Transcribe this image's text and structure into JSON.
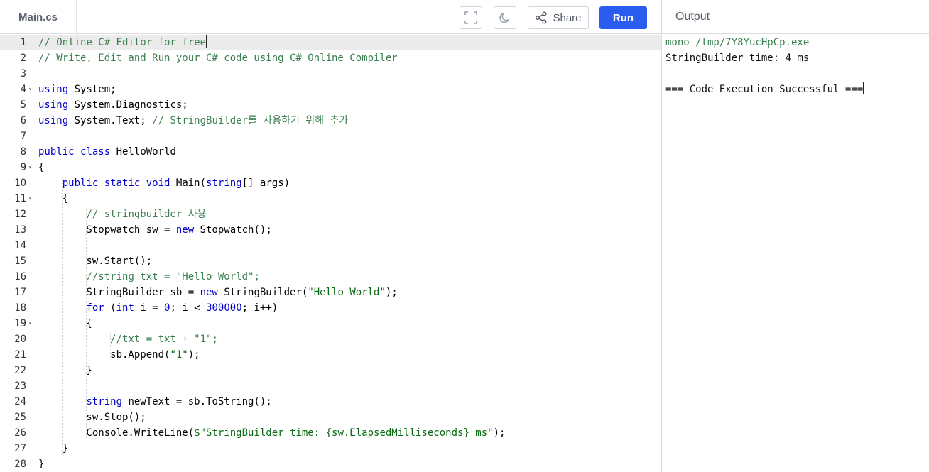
{
  "editor": {
    "file_tab": "Main.cs",
    "share_label": "Share",
    "run_label": "Run",
    "lines": [
      {
        "n": "1",
        "tokens": [
          [
            "comment",
            "// Online C# Editor for free"
          ]
        ],
        "cursor": true,
        "active": true
      },
      {
        "n": "2",
        "tokens": [
          [
            "comment",
            "// Write, Edit and Run your C# code using C# Online Compiler"
          ]
        ]
      },
      {
        "n": "3",
        "tokens": []
      },
      {
        "n": "4",
        "fold": true,
        "tokens": [
          [
            "kw",
            "using"
          ],
          [
            "plain",
            " System;"
          ]
        ]
      },
      {
        "n": "5",
        "tokens": [
          [
            "kw",
            "using"
          ],
          [
            "plain",
            " System.Diagnostics;"
          ]
        ]
      },
      {
        "n": "6",
        "tokens": [
          [
            "kw",
            "using"
          ],
          [
            "plain",
            " System.Text; "
          ],
          [
            "comment",
            "// StringBuilder를 사용하기 위해 추가"
          ]
        ]
      },
      {
        "n": "7",
        "tokens": []
      },
      {
        "n": "8",
        "tokens": [
          [
            "kw",
            "public"
          ],
          [
            "plain",
            " "
          ],
          [
            "kw",
            "class"
          ],
          [
            "plain",
            " HelloWorld"
          ]
        ]
      },
      {
        "n": "9",
        "fold": true,
        "tokens": [
          [
            "plain",
            "{"
          ]
        ]
      },
      {
        "n": "10",
        "tokens": [
          [
            "plain",
            "    "
          ],
          [
            "kw",
            "public"
          ],
          [
            "plain",
            " "
          ],
          [
            "kw",
            "static"
          ],
          [
            "plain",
            " "
          ],
          [
            "kw",
            "void"
          ],
          [
            "plain",
            " Main("
          ],
          [
            "kw",
            "string"
          ],
          [
            "plain",
            "[] args)"
          ]
        ]
      },
      {
        "n": "11",
        "fold": true,
        "tokens": [
          [
            "plain",
            "    {"
          ]
        ]
      },
      {
        "n": "12",
        "tokens": [
          [
            "plain",
            "        "
          ],
          [
            "comment",
            "// stringbuilder 사용"
          ]
        ]
      },
      {
        "n": "13",
        "tokens": [
          [
            "plain",
            "        Stopwatch sw = "
          ],
          [
            "kw",
            "new"
          ],
          [
            "plain",
            " Stopwatch();"
          ]
        ]
      },
      {
        "n": "14",
        "tokens": []
      },
      {
        "n": "15",
        "tokens": [
          [
            "plain",
            "        sw.Start();"
          ]
        ]
      },
      {
        "n": "16",
        "tokens": [
          [
            "plain",
            "        "
          ],
          [
            "comment",
            "//string txt = \"Hello World\";"
          ]
        ]
      },
      {
        "n": "17",
        "tokens": [
          [
            "plain",
            "        StringBuilder sb = "
          ],
          [
            "kw",
            "new"
          ],
          [
            "plain",
            " StringBuilder("
          ],
          [
            "str",
            "\"Hello World\""
          ],
          [
            "plain",
            ");"
          ]
        ]
      },
      {
        "n": "18",
        "tokens": [
          [
            "plain",
            "        "
          ],
          [
            "kw",
            "for"
          ],
          [
            "plain",
            " ("
          ],
          [
            "kw",
            "int"
          ],
          [
            "plain",
            " i = "
          ],
          [
            "num",
            "0"
          ],
          [
            "plain",
            "; i < "
          ],
          [
            "num",
            "300000"
          ],
          [
            "plain",
            "; i++)"
          ]
        ]
      },
      {
        "n": "19",
        "fold": true,
        "tokens": [
          [
            "plain",
            "        {"
          ]
        ]
      },
      {
        "n": "20",
        "tokens": [
          [
            "plain",
            "            "
          ],
          [
            "comment",
            "//txt = txt + \"1\";"
          ]
        ]
      },
      {
        "n": "21",
        "tokens": [
          [
            "plain",
            "            sb.Append("
          ],
          [
            "str",
            "\"1\""
          ],
          [
            "plain",
            ");"
          ]
        ]
      },
      {
        "n": "22",
        "tokens": [
          [
            "plain",
            "        }"
          ]
        ]
      },
      {
        "n": "23",
        "tokens": []
      },
      {
        "n": "24",
        "tokens": [
          [
            "plain",
            "        "
          ],
          [
            "kw",
            "string"
          ],
          [
            "plain",
            " newText = sb.ToString();"
          ]
        ]
      },
      {
        "n": "25",
        "tokens": [
          [
            "plain",
            "        sw.Stop();"
          ]
        ]
      },
      {
        "n": "26",
        "tokens": [
          [
            "plain",
            "        Console.WriteLine("
          ],
          [
            "str",
            "$\"StringBuilder time: {sw.ElapsedMilliseconds} ms\""
          ],
          [
            "plain",
            ");"
          ]
        ]
      },
      {
        "n": "27",
        "tokens": [
          [
            "plain",
            "    }"
          ]
        ]
      },
      {
        "n": "28",
        "tokens": [
          [
            "plain",
            "}"
          ]
        ]
      }
    ]
  },
  "output": {
    "title": "Output",
    "lines": [
      {
        "text": "mono /tmp/7Y8YucHpCp.exe",
        "kind": "cmd"
      },
      {
        "text": "StringBuilder time: 4 ms",
        "kind": "out"
      },
      {
        "text": "",
        "kind": "out"
      },
      {
        "text": "=== Code Execution Successful ===",
        "kind": "out",
        "cursor": true
      }
    ]
  },
  "icons": {
    "fullscreen": "fullscreen-icon",
    "theme": "moon-icon",
    "share": "share-icon"
  }
}
